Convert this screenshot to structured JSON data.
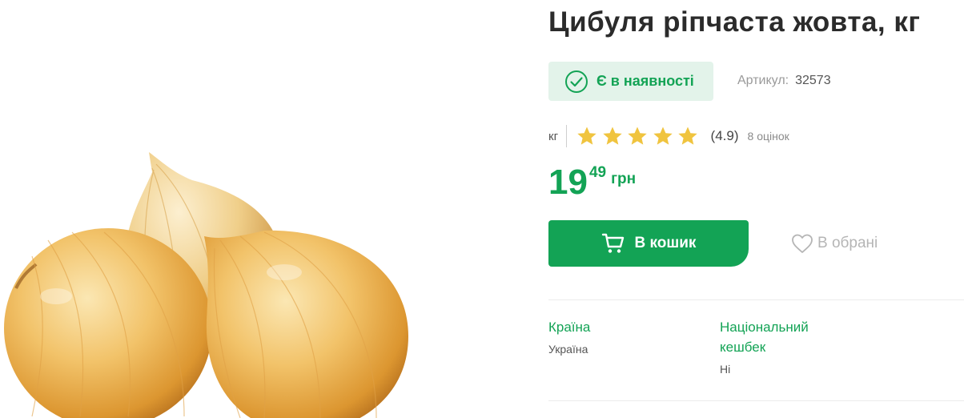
{
  "product": {
    "title": "Цибуля ріпчаста жовта, кг",
    "image_icon": "onion-image"
  },
  "stock": {
    "label": "Є в наявності",
    "icon": "check-circle-icon"
  },
  "sku": {
    "label": "Артикул:",
    "value": "32573"
  },
  "rating": {
    "unit": "кг",
    "stars_filled": 5,
    "stars_total": 5,
    "value": "(4.9)",
    "count": "8 оцінок"
  },
  "price": {
    "integer": "19",
    "fraction": "49",
    "currency": "грн"
  },
  "actions": {
    "cart_label": "В кошик",
    "cart_icon": "cart-icon",
    "favorite_label": "В обрані",
    "favorite_icon": "heart-icon"
  },
  "attributes": [
    {
      "name": "Країна",
      "value": "Україна"
    },
    {
      "name_line1": "Національний",
      "name_line2": "кешбек",
      "value": "Ні"
    }
  ],
  "colors": {
    "accent_green": "#13a355",
    "badge_bg": "#e3f3ea",
    "star_gold": "#f0c43f"
  }
}
